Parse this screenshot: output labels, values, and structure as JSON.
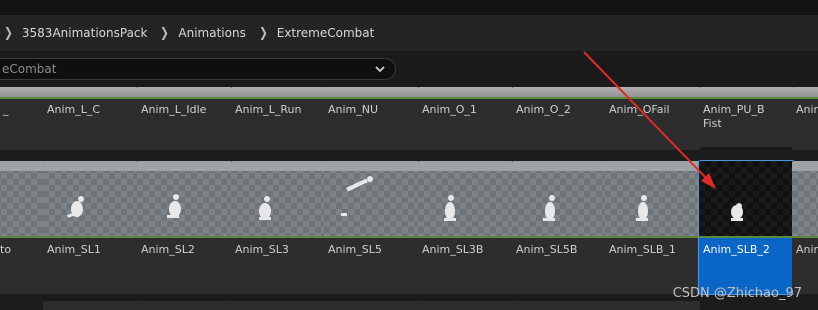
{
  "breadcrumb": {
    "items": [
      "3583AnimationsPack",
      "Animations",
      "ExtremeCombat"
    ]
  },
  "search": {
    "value": "eCombat"
  },
  "rows": {
    "row1": [
      "_",
      "Anim_L_C",
      "Anim_L_Idle",
      "Anim_L_Run",
      "Anim_NU",
      "Anim_O_1",
      "Anim_O_2",
      "Anim_OFail",
      "Anim_PU_B\nFist",
      "Anim"
    ],
    "row2": [
      "to",
      "Anim_SL1",
      "Anim_SL2",
      "Anim_SL3",
      "Anim_SL5",
      "Anim_SL3B",
      "Anim_SL5B",
      "Anim_SLB_1",
      "Anim_SLB_2",
      "Anim"
    ]
  },
  "selected_tile": "Anim_SLB_2",
  "watermark": "CSDN @Zhichao_97",
  "colors": {
    "background": "#1c1c1c",
    "tile": "#2d2d2d",
    "selected": "#0a66c6",
    "annotation_arrow": "#e02a2a",
    "divider_green": "#5b8a3c"
  }
}
